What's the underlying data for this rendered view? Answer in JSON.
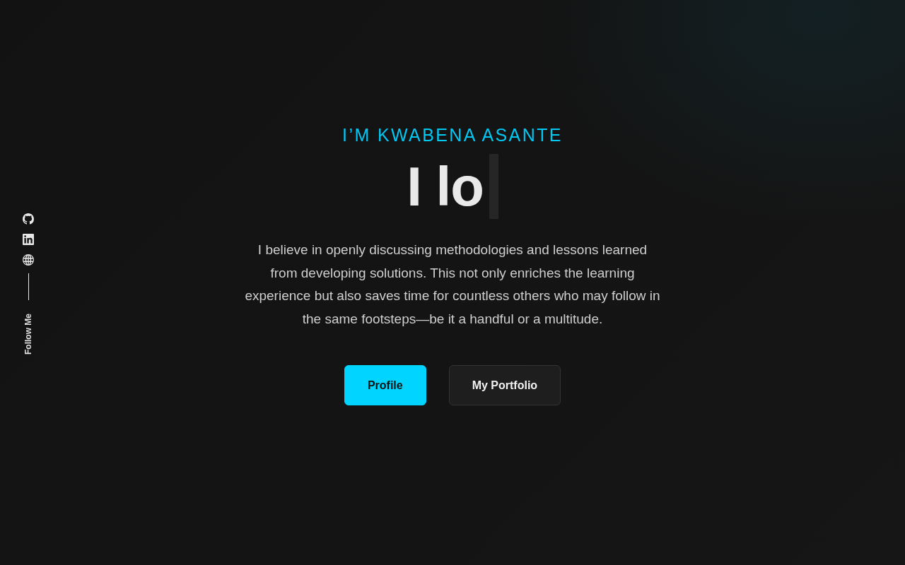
{
  "social_rail": {
    "label": "Follow Me"
  },
  "hero": {
    "eyebrow": "I’M KWABENA ASANTE",
    "typed_heading": "I lo",
    "paragraph": "I believe in openly discussing methodologies and lessons learned from developing solutions. This not only enriches the learning experience but also saves time for countless others who may follow in the same footsteps—be it a handful or a multitude.",
    "buttons": [
      {
        "label": "Profile",
        "kind": "primary"
      },
      {
        "label": "My Portfolio",
        "kind": "secondary"
      }
    ]
  }
}
